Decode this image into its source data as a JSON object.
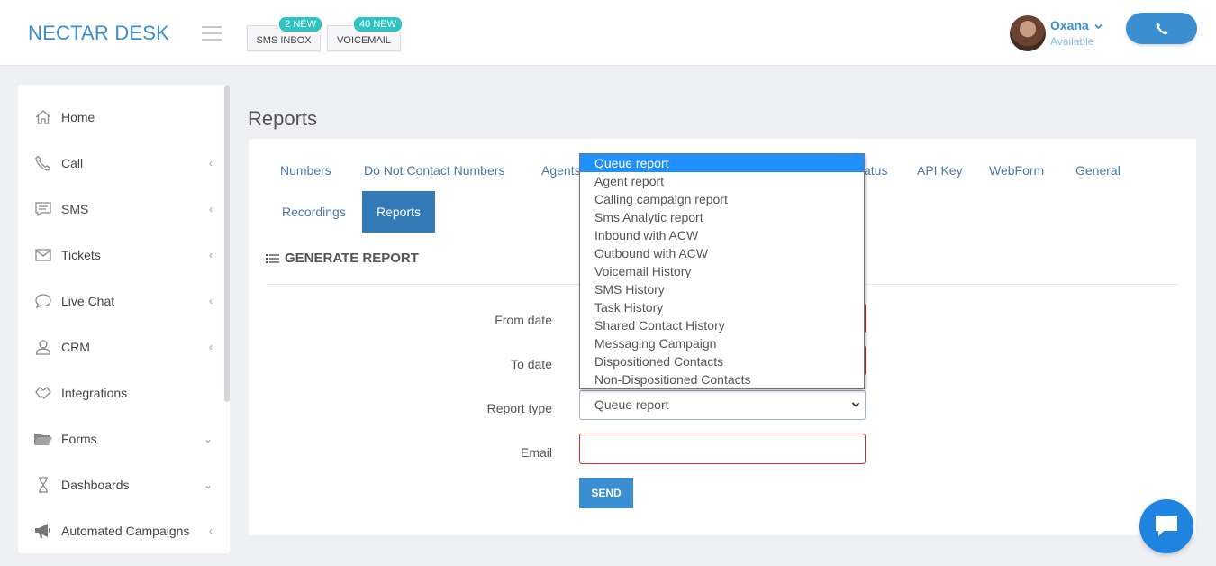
{
  "header": {
    "brand": "NECTAR DESK",
    "sms_inbox": {
      "label": "SMS INBOX",
      "badge": "2 NEW"
    },
    "voicemail": {
      "label": "VOICEMAIL",
      "badge": "40 NEW"
    },
    "user": {
      "name": "Oxana",
      "status": "Available"
    }
  },
  "sidebar": {
    "items": [
      {
        "label": "Home",
        "chevron": ""
      },
      {
        "label": "Call",
        "chevron": "‹"
      },
      {
        "label": "SMS",
        "chevron": "‹"
      },
      {
        "label": "Tickets",
        "chevron": "‹"
      },
      {
        "label": "Live Chat",
        "chevron": "‹"
      },
      {
        "label": "CRM",
        "chevron": "‹"
      },
      {
        "label": "Integrations",
        "chevron": ""
      },
      {
        "label": "Forms",
        "chevron": "⌄"
      },
      {
        "label": "Dashboards",
        "chevron": "⌄"
      },
      {
        "label": "Automated Campaigns",
        "chevron": "‹"
      }
    ]
  },
  "page": {
    "title": "Reports"
  },
  "tabs": {
    "numbers": "Numbers",
    "dnc": "Do Not Contact Numbers",
    "agents": "Agents",
    "status": "atus",
    "api_key": "API Key",
    "webform": "WebForm",
    "general": "General",
    "recordings": "Recordings",
    "reports": "Reports"
  },
  "section": {
    "title": "GENERATE REPORT"
  },
  "form": {
    "from_label": "From date",
    "to_label": "To date",
    "type_label": "Report type",
    "type_value": "Queue report",
    "email_label": "Email",
    "send_label": "SEND"
  },
  "dropdown": {
    "options": [
      "Queue report",
      "Agent report",
      "Calling campaign report",
      "Sms Analytic report",
      "Inbound with ACW",
      "Outbound with ACW",
      "Voicemail History",
      "SMS History",
      "Task History",
      "Shared Contact History",
      "Messaging Campaign",
      "Dispositioned Contacts",
      "Non-Dispositioned Contacts"
    ]
  },
  "colors": {
    "brand": "#3b8fd1",
    "badge": "#2ec4c4",
    "tab_active": "#337ab7",
    "error_border": "#c9302c",
    "dropdown_highlight": "#1e90ff"
  }
}
